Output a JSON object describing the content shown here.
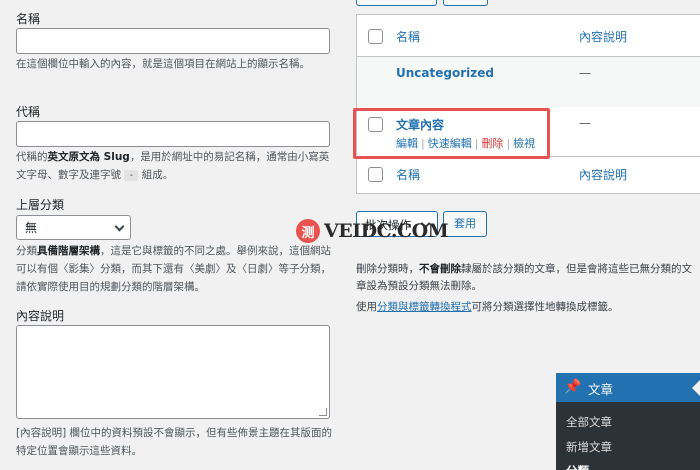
{
  "form": {
    "name_label": "名稱",
    "name_desc": "在這個欄位中輸入的內容，就是這個項目在網站上的顯示名稱。",
    "slug_label": "代稱",
    "slug_desc_pre": "代稱的",
    "slug_desc_bold": "英文原文為 Slug",
    "slug_desc_post": "，是用於網址中的易記名稱，通常由小寫英文字母、數字及連字號",
    "slug_desc_code": "-",
    "slug_desc_end": "組成。",
    "parent_label": "上層分類",
    "parent_value": "無",
    "parent_desc_pre": "分類",
    "parent_desc_bold": "具備階層架構",
    "parent_desc_post": "，這是它與標籤的不同之處。舉例來說，這個網站可以有個〈影集〉分類，而其下還有〈美劇〉及〈日劇〉等子分類，請依實際使用目的規劃分類的階層架構。",
    "description_label": "內容說明",
    "description_desc": "[內容說明] 欄位中的資料預設不會顯示，但有些佈景主題在其版面的特定位置會顯示這些資料。"
  },
  "table": {
    "col_name": "名稱",
    "col_description": "內容說明",
    "rows": [
      {
        "name": "Uncategorized",
        "description": "—"
      },
      {
        "name": "文章內容",
        "description": "—"
      }
    ],
    "row_actions": {
      "edit": "編輯",
      "quick_edit": "快速編輯",
      "delete": "刪除",
      "view": "檢視",
      "sep": "|"
    }
  },
  "bulk": {
    "select_label": "批次操作",
    "apply_label": "套用"
  },
  "notes": {
    "delete_pre": "刪除分類時，",
    "delete_bold": "不會刪除",
    "delete_post": "隸屬於該分類的文章，但是會將這些已無分類的文章設為預設分類無法刪除。",
    "convert_pre": "使用",
    "convert_link": "分類與標籤轉換程式",
    "convert_post": "可將分類選擇性地轉換成標籤。"
  },
  "watermark": {
    "seal": "测",
    "text": "VEIDC.COM"
  },
  "menu": {
    "title": "文章",
    "items": [
      "全部文章",
      "新增文章",
      "分類"
    ]
  },
  "colors": {
    "link": "#2271b1",
    "delete": "#d63638",
    "highlight": "#e55353",
    "menu_bg": "#2c3338",
    "menu_active": "#2271b1"
  }
}
